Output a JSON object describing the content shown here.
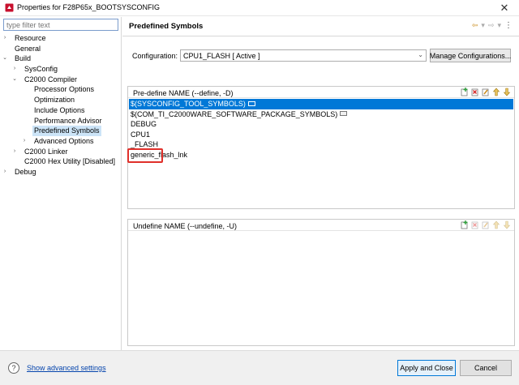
{
  "window": {
    "title": "Properties for F28P65x_BOOTSYSCONFIG",
    "close_glyph": "✕"
  },
  "left": {
    "filter_placeholder": "type filter text",
    "tree": [
      {
        "label": "Resource",
        "level": 0,
        "toggle": "›"
      },
      {
        "label": "General",
        "level": 0,
        "toggle": ""
      },
      {
        "label": "Build",
        "level": 0,
        "toggle": "⌄"
      },
      {
        "label": "SysConfig",
        "level": 1,
        "toggle": "›"
      },
      {
        "label": "C2000 Compiler",
        "level": 1,
        "toggle": "⌄"
      },
      {
        "label": "Processor Options",
        "level": 2,
        "toggle": ""
      },
      {
        "label": "Optimization",
        "level": 2,
        "toggle": ""
      },
      {
        "label": "Include Options",
        "level": 2,
        "toggle": ""
      },
      {
        "label": "Performance Advisor",
        "level": 2,
        "toggle": ""
      },
      {
        "label": "Predefined Symbols",
        "level": 2,
        "toggle": "",
        "selected": true
      },
      {
        "label": "Advanced Options",
        "level": 2,
        "toggle": "›"
      },
      {
        "label": "C2000 Linker",
        "level": 1,
        "toggle": "›"
      },
      {
        "label": "C2000 Hex Utility  [Disabled]",
        "level": 1,
        "toggle": ""
      },
      {
        "label": "Debug",
        "level": 0,
        "toggle": "›"
      }
    ]
  },
  "main": {
    "page_title": "Predefined Symbols",
    "nav": {
      "back": "⇦",
      "back_menu": "▾",
      "forward": "⇨",
      "forward_menu": "▾",
      "menu": "⋮"
    },
    "configuration_label": "Configuration:",
    "configuration_value": "CPU1_FLASH  [ Active ]",
    "manage_button": "Manage Configurations...",
    "predefine": {
      "title": "Pre-define NAME (--define, -D)",
      "items": [
        {
          "text": "$(SYSCONFIG_TOOL_SYMBOLS)",
          "more": true,
          "selected": true
        },
        {
          "text": "$(COM_TI_C2000WARE_SOFTWARE_PACKAGE_SYMBOLS)",
          "more": true
        },
        {
          "text": "DEBUG"
        },
        {
          "text": "CPU1"
        },
        {
          "text": "_FLASH"
        },
        {
          "text": "generic_flash_lnk"
        }
      ]
    },
    "undefine": {
      "title": "Undefine NAME (--undefine, -U)",
      "items": []
    }
  },
  "footer": {
    "help_glyph": "?",
    "advanced_link": "Show advanced settings",
    "apply_close": "Apply and Close",
    "cancel": "Cancel"
  },
  "colors": {
    "selection": "#0078d7",
    "tree_selection": "#cce4f7",
    "highlight_box": "#e0302a",
    "link": "#0645ad"
  }
}
